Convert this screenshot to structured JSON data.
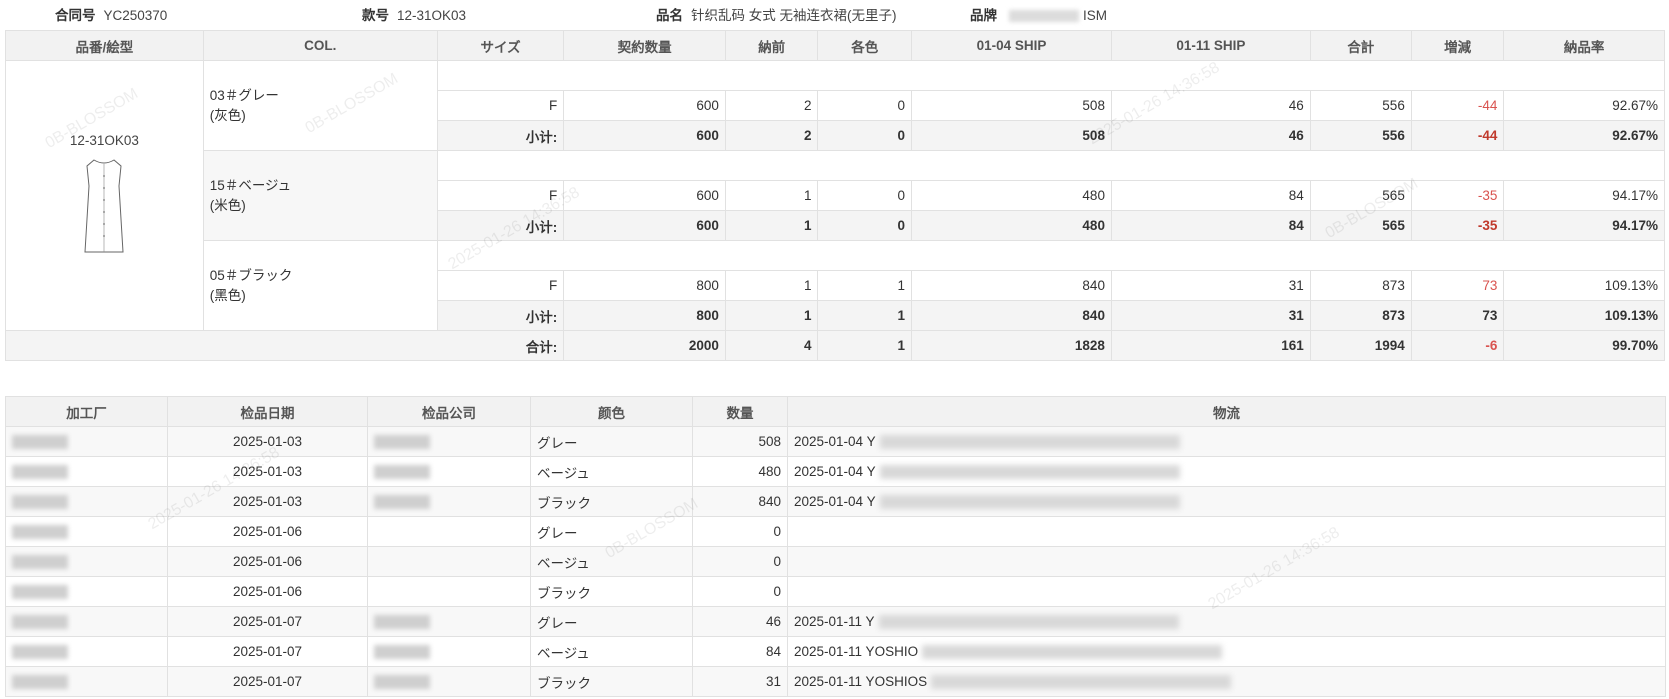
{
  "header": {
    "contract_label": "合同号",
    "contract_value": "YC250370",
    "style_label": "款号",
    "style_value": "12-31OK03",
    "product_label": "品名",
    "product_value": "针织乱码 女式 无袖连衣裙(无里子)",
    "brand_label": "品牌",
    "brand_value": "ISM"
  },
  "table1": {
    "headers": [
      "品番/絵型",
      "COL.",
      "サイズ",
      "契約数量",
      "納前",
      "各色",
      "01-04 SHIP",
      "01-11 SHIP",
      "合計",
      "増減",
      "納品率"
    ],
    "style_no": "12-31OK03",
    "colors": [
      {
        "name": "03＃グレー",
        "cn": "(灰色)",
        "size": "F",
        "qty": "600",
        "nouzen": "2",
        "kakushoku": "0",
        "ship1": "508",
        "ship2": "46",
        "total": "556",
        "diff": "-44",
        "rate": "92.67%"
      },
      {
        "name": "15＃ベージュ",
        "cn": "(米色)",
        "size": "F",
        "qty": "600",
        "nouzen": "1",
        "kakushoku": "0",
        "ship1": "480",
        "ship2": "84",
        "total": "565",
        "diff": "-35",
        "rate": "94.17%"
      },
      {
        "name": "05＃ブラック",
        "cn": "(黑色)",
        "size": "F",
        "qty": "800",
        "nouzen": "1",
        "kakushoku": "1",
        "ship1": "840",
        "ship2": "31",
        "total": "873",
        "diff": "73",
        "rate": "109.13%"
      }
    ],
    "subtotal_label": "小计:",
    "grand_label": "合计:",
    "grand": {
      "qty": "2000",
      "nouzen": "4",
      "kakushoku": "1",
      "ship1": "1828",
      "ship2": "161",
      "total": "1994",
      "diff": "-6",
      "rate": "99.70%"
    }
  },
  "table2": {
    "headers": [
      "加工厂",
      "检品日期",
      "检品公司",
      "颜色",
      "数量",
      "物流"
    ],
    "rows": [
      {
        "date": "2025-01-03",
        "color": "グレー",
        "qty": "508",
        "log": "2025-01-04 Y"
      },
      {
        "date": "2025-01-03",
        "color": "ベージュ",
        "qty": "480",
        "log": "2025-01-04 Y"
      },
      {
        "date": "2025-01-03",
        "color": "ブラック",
        "qty": "840",
        "log": "2025-01-04 Y"
      },
      {
        "date": "2025-01-06",
        "color": "グレー",
        "qty": "0",
        "log": ""
      },
      {
        "date": "2025-01-06",
        "color": "ベージュ",
        "qty": "0",
        "log": ""
      },
      {
        "date": "2025-01-06",
        "color": "ブラック",
        "qty": "0",
        "log": ""
      },
      {
        "date": "2025-01-07",
        "color": "グレー",
        "qty": "46",
        "log": "2025-01-11 Y"
      },
      {
        "date": "2025-01-07",
        "color": "ベージュ",
        "qty": "84",
        "log": "2025-01-11 YOSHIO"
      },
      {
        "date": "2025-01-07",
        "color": "ブラック",
        "qty": "31",
        "log": "2025-01-11 YOSHIOS"
      }
    ]
  },
  "watermark": [
    "0B-BLOSSOM",
    "2025-01-26 14:36:58"
  ]
}
